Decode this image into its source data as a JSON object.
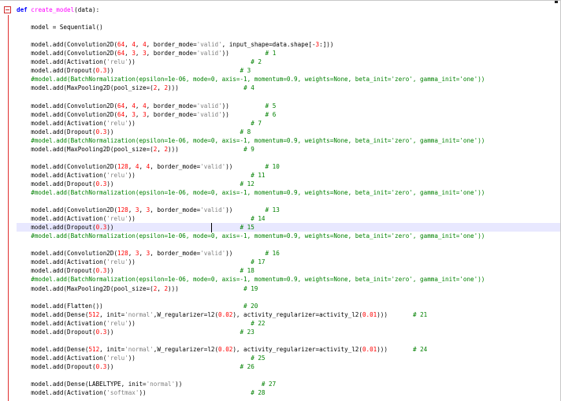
{
  "editor": {
    "highlighted_line": 25,
    "lines": [
      [
        [
          "kw",
          "def "
        ],
        [
          "fn",
          "create_model"
        ],
        [
          "tx",
          "(data):"
        ]
      ],
      [],
      [
        [
          "tx",
          "    model = Sequential()"
        ]
      ],
      [],
      [
        [
          "tx",
          "    model.add(Convolution2D("
        ],
        [
          "num",
          "64"
        ],
        [
          "tx",
          ", "
        ],
        [
          "num",
          "4"
        ],
        [
          "tx",
          ", "
        ],
        [
          "num",
          "4"
        ],
        [
          "tx",
          ", border_mode="
        ],
        [
          "str",
          "'valid'"
        ],
        [
          "tx",
          ", input_shape=data.shape[-"
        ],
        [
          "num",
          "3"
        ],
        [
          "tx",
          ":]))"
        ]
      ],
      [
        [
          "tx",
          "    model.add(Convolution2D("
        ],
        [
          "num",
          "64"
        ],
        [
          "tx",
          ", "
        ],
        [
          "num",
          "3"
        ],
        [
          "tx",
          ", "
        ],
        [
          "num",
          "3"
        ],
        [
          "tx",
          ", border_mode="
        ],
        [
          "str",
          "'valid'"
        ],
        [
          "tx",
          "))          "
        ],
        [
          "cm",
          "# 1"
        ]
      ],
      [
        [
          "tx",
          "    model.add(Activation("
        ],
        [
          "str",
          "'relu'"
        ],
        [
          "tx",
          "))                                "
        ],
        [
          "cm",
          "# 2"
        ]
      ],
      [
        [
          "tx",
          "    model.add(Dropout("
        ],
        [
          "num",
          "0.3"
        ],
        [
          "tx",
          "))                                   "
        ],
        [
          "cm",
          "# 3"
        ]
      ],
      [
        [
          "cm",
          "    #model.add(BatchNormalization(epsilon=1e-06, mode=0, axis=-1, momentum=0.9, weights=None, beta_init='zero', gamma_init='one'))"
        ]
      ],
      [
        [
          "tx",
          "    model.add(MaxPooling2D(pool_size=("
        ],
        [
          "num",
          "2"
        ],
        [
          "tx",
          ", "
        ],
        [
          "num",
          "2"
        ],
        [
          "tx",
          ")))                  "
        ],
        [
          "cm",
          "# 4"
        ]
      ],
      [],
      [
        [
          "tx",
          "    model.add(Convolution2D("
        ],
        [
          "num",
          "64"
        ],
        [
          "tx",
          ", "
        ],
        [
          "num",
          "4"
        ],
        [
          "tx",
          ", "
        ],
        [
          "num",
          "4"
        ],
        [
          "tx",
          ", border_mode="
        ],
        [
          "str",
          "'valid'"
        ],
        [
          "tx",
          "))          "
        ],
        [
          "cm",
          "# 5"
        ]
      ],
      [
        [
          "tx",
          "    model.add(Convolution2D("
        ],
        [
          "num",
          "64"
        ],
        [
          "tx",
          ", "
        ],
        [
          "num",
          "3"
        ],
        [
          "tx",
          ", "
        ],
        [
          "num",
          "3"
        ],
        [
          "tx",
          ", border_mode="
        ],
        [
          "str",
          "'valid'"
        ],
        [
          "tx",
          "))          "
        ],
        [
          "cm",
          "# 6"
        ]
      ],
      [
        [
          "tx",
          "    model.add(Activation("
        ],
        [
          "str",
          "'relu'"
        ],
        [
          "tx",
          "))                                "
        ],
        [
          "cm",
          "# 7"
        ]
      ],
      [
        [
          "tx",
          "    model.add(Dropout("
        ],
        [
          "num",
          "0.3"
        ],
        [
          "tx",
          "))                                   "
        ],
        [
          "cm",
          "# 8"
        ]
      ],
      [
        [
          "cm",
          "    #model.add(BatchNormalization(epsilon=1e-06, mode=0, axis=-1, momentum=0.9, weights=None, beta_init='zero', gamma_init='one'))"
        ]
      ],
      [
        [
          "tx",
          "    model.add(MaxPooling2D(pool_size=("
        ],
        [
          "num",
          "2"
        ],
        [
          "tx",
          ", "
        ],
        [
          "num",
          "2"
        ],
        [
          "tx",
          ")))                  "
        ],
        [
          "cm",
          "# 9"
        ]
      ],
      [],
      [
        [
          "tx",
          "    model.add(Convolution2D("
        ],
        [
          "num",
          "128"
        ],
        [
          "tx",
          ", "
        ],
        [
          "num",
          "4"
        ],
        [
          "tx",
          ", "
        ],
        [
          "num",
          "4"
        ],
        [
          "tx",
          ", border_mode="
        ],
        [
          "str",
          "'valid'"
        ],
        [
          "tx",
          "))         "
        ],
        [
          "cm",
          "# 10"
        ]
      ],
      [
        [
          "tx",
          "    model.add(Activation("
        ],
        [
          "str",
          "'relu'"
        ],
        [
          "tx",
          "))                                "
        ],
        [
          "cm",
          "# 11"
        ]
      ],
      [
        [
          "tx",
          "    model.add(Dropout("
        ],
        [
          "num",
          "0.3"
        ],
        [
          "tx",
          "))                                   "
        ],
        [
          "cm",
          "# 12"
        ]
      ],
      [
        [
          "cm",
          "    #model.add(BatchNormalization(epsilon=1e-06, mode=0, axis=-1, momentum=0.9, weights=None, beta_init='zero', gamma_init='one'))"
        ]
      ],
      [],
      [
        [
          "tx",
          "    model.add(Convolution2D("
        ],
        [
          "num",
          "128"
        ],
        [
          "tx",
          ", "
        ],
        [
          "num",
          "3"
        ],
        [
          "tx",
          ", "
        ],
        [
          "num",
          "3"
        ],
        [
          "tx",
          ", border_mode="
        ],
        [
          "str",
          "'valid'"
        ],
        [
          "tx",
          "))         "
        ],
        [
          "cm",
          "# 13"
        ]
      ],
      [
        [
          "tx",
          "    model.add(Activation("
        ],
        [
          "str",
          "'relu'"
        ],
        [
          "tx",
          "))                                "
        ],
        [
          "cm",
          "# 14"
        ]
      ],
      [
        [
          "tx",
          "    model.add(Dropout("
        ],
        [
          "num",
          "0.3"
        ],
        [
          "tx",
          "))                                   "
        ],
        [
          "cm",
          "# 15"
        ]
      ],
      [
        [
          "cm",
          "    #model.add(BatchNormalization(epsilon=1e-06, mode=0, axis=-1, momentum=0.9, weights=None, beta_init='zero', gamma_init='one'))"
        ]
      ],
      [],
      [
        [
          "tx",
          "    model.add(Convolution2D("
        ],
        [
          "num",
          "128"
        ],
        [
          "tx",
          ", "
        ],
        [
          "num",
          "3"
        ],
        [
          "tx",
          ", "
        ],
        [
          "num",
          "3"
        ],
        [
          "tx",
          ", border_mode="
        ],
        [
          "str",
          "'valid'"
        ],
        [
          "tx",
          "))         "
        ],
        [
          "cm",
          "# 16"
        ]
      ],
      [
        [
          "tx",
          "    model.add(Activation("
        ],
        [
          "str",
          "'relu'"
        ],
        [
          "tx",
          "))                                "
        ],
        [
          "cm",
          "# 17"
        ]
      ],
      [
        [
          "tx",
          "    model.add(Dropout("
        ],
        [
          "num",
          "0.3"
        ],
        [
          "tx",
          "))                                   "
        ],
        [
          "cm",
          "# 18"
        ]
      ],
      [
        [
          "cm",
          "    #model.add(BatchNormalization(epsilon=1e-06, mode=0, axis=-1, momentum=0.9, weights=None, beta_init='zero', gamma_init='one'))"
        ]
      ],
      [
        [
          "tx",
          "    model.add(MaxPooling2D(pool_size=("
        ],
        [
          "num",
          "2"
        ],
        [
          "tx",
          ", "
        ],
        [
          "num",
          "2"
        ],
        [
          "tx",
          ")))                  "
        ],
        [
          "cm",
          "# 19"
        ]
      ],
      [],
      [
        [
          "tx",
          "    model.add(Flatten())                                       "
        ],
        [
          "cm",
          "# 20"
        ]
      ],
      [
        [
          "tx",
          "    model.add(Dense("
        ],
        [
          "num",
          "512"
        ],
        [
          "tx",
          ", init="
        ],
        [
          "str",
          "'normal'"
        ],
        [
          "tx",
          ",W_regularizer=l2("
        ],
        [
          "num",
          "0.02"
        ],
        [
          "tx",
          "), activity_regularizer=activity_l2("
        ],
        [
          "num",
          "0.01"
        ],
        [
          "tx",
          ")))       "
        ],
        [
          "cm",
          "# 21"
        ]
      ],
      [
        [
          "tx",
          "    model.add(Activation("
        ],
        [
          "str",
          "'relu'"
        ],
        [
          "tx",
          "))                                "
        ],
        [
          "cm",
          "# 22"
        ]
      ],
      [
        [
          "tx",
          "    model.add(Dropout("
        ],
        [
          "num",
          "0.3"
        ],
        [
          "tx",
          "))                                   "
        ],
        [
          "cm",
          "# 23"
        ]
      ],
      [],
      [
        [
          "tx",
          "    model.add(Dense("
        ],
        [
          "num",
          "512"
        ],
        [
          "tx",
          ", init="
        ],
        [
          "str",
          "'normal'"
        ],
        [
          "tx",
          ",W_regularizer=l2("
        ],
        [
          "num",
          "0.02"
        ],
        [
          "tx",
          "), activity_regularizer=activity_l2("
        ],
        [
          "num",
          "0.01"
        ],
        [
          "tx",
          ")))       "
        ],
        [
          "cm",
          "# 24"
        ]
      ],
      [
        [
          "tx",
          "    model.add(Activation("
        ],
        [
          "str",
          "'relu'"
        ],
        [
          "tx",
          "))                                "
        ],
        [
          "cm",
          "# 25"
        ]
      ],
      [
        [
          "tx",
          "    model.add(Dropout("
        ],
        [
          "num",
          "0.3"
        ],
        [
          "tx",
          "))                                   "
        ],
        [
          "cm",
          "# 26"
        ]
      ],
      [],
      [
        [
          "tx",
          "    model.add(Dense(LABELTYPE, init="
        ],
        [
          "str",
          "'normal'"
        ],
        [
          "tx",
          "))                      "
        ],
        [
          "cm",
          "# 27"
        ]
      ],
      [
        [
          "tx",
          "    model.add(Activation("
        ],
        [
          "str",
          "'softmax'"
        ],
        [
          "tx",
          "))                             "
        ],
        [
          "cm",
          "# 28"
        ]
      ]
    ]
  }
}
